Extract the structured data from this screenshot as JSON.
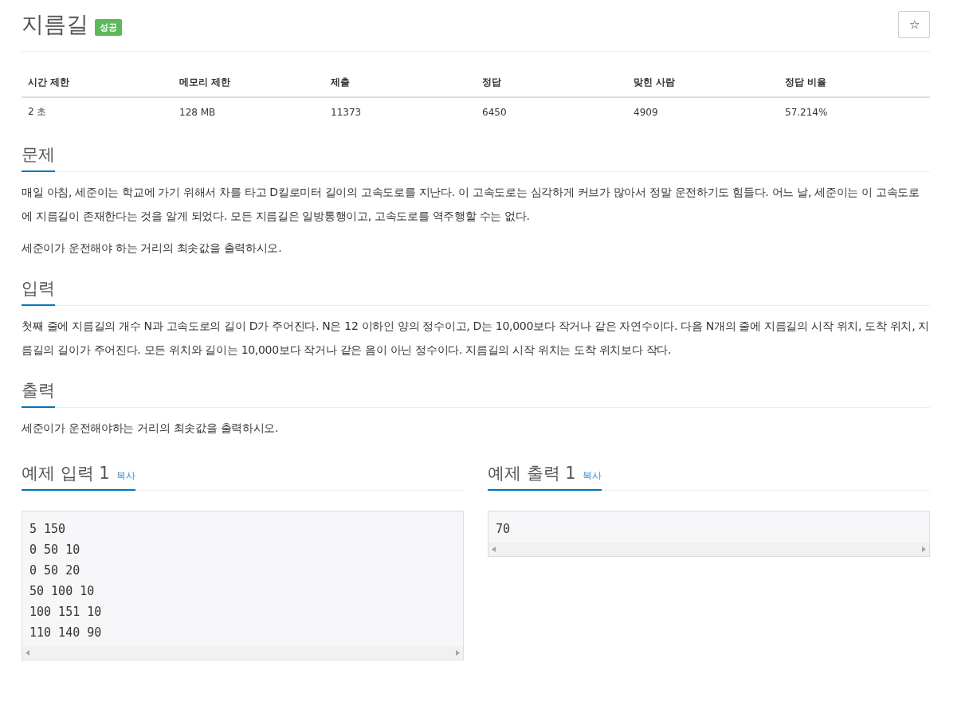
{
  "title": "지름길",
  "badge": "성공",
  "star_button": "☆",
  "info_table": {
    "columns": [
      "시간 제한",
      "메모리 제한",
      "제출",
      "정답",
      "맞힌 사람",
      "정답 비율"
    ],
    "rows": [
      [
        "2 초",
        "128 MB",
        "11373",
        "6450",
        "4909",
        "57.214%"
      ]
    ]
  },
  "sections": [
    {
      "heading": "문제",
      "paragraphs": [
        "매일 아침, 세준이는 학교에 가기 위해서 차를 타고 D킬로미터 길이의 고속도로를 지난다. 이 고속도로는 심각하게 커브가 많아서 정말 운전하기도 힘들다. 어느 날, 세준이는 이 고속도로에 지름길이 존재한다는 것을 알게 되었다. 모든 지름길은 일방통행이고, 고속도로를 역주행할 수는 없다.",
        "세준이가 운전해야 하는 거리의 최솟값을 출력하시오."
      ]
    },
    {
      "heading": "입력",
      "paragraphs": [
        "첫째 줄에 지름길의 개수 N과 고속도로의 길이 D가 주어진다. N은 12 이하인 양의 정수이고, D는 10,000보다 작거나 같은 자연수이다. 다음 N개의 줄에 지름길의 시작 위치, 도착 위치, 지름길의 길이가 주어진다. 모든 위치와 길이는 10,000보다 작거나 같은 음이 아닌 정수이다. 지름길의 시작 위치는 도착 위치보다 작다."
      ]
    },
    {
      "heading": "출력",
      "paragraphs": [
        "세준이가 운전해야하는 거리의 최솟값을 출력하시오."
      ]
    }
  ],
  "samples": [
    {
      "heading": "예제 입력 1",
      "copy": "복사",
      "lines": [
        "5 150",
        "0 50 10",
        "0 50 20",
        "50 100 10",
        "100 151 10",
        "110 140 90"
      ]
    },
    {
      "heading": "예제 출력 1",
      "copy": "복사",
      "lines": [
        "70"
      ]
    }
  ]
}
